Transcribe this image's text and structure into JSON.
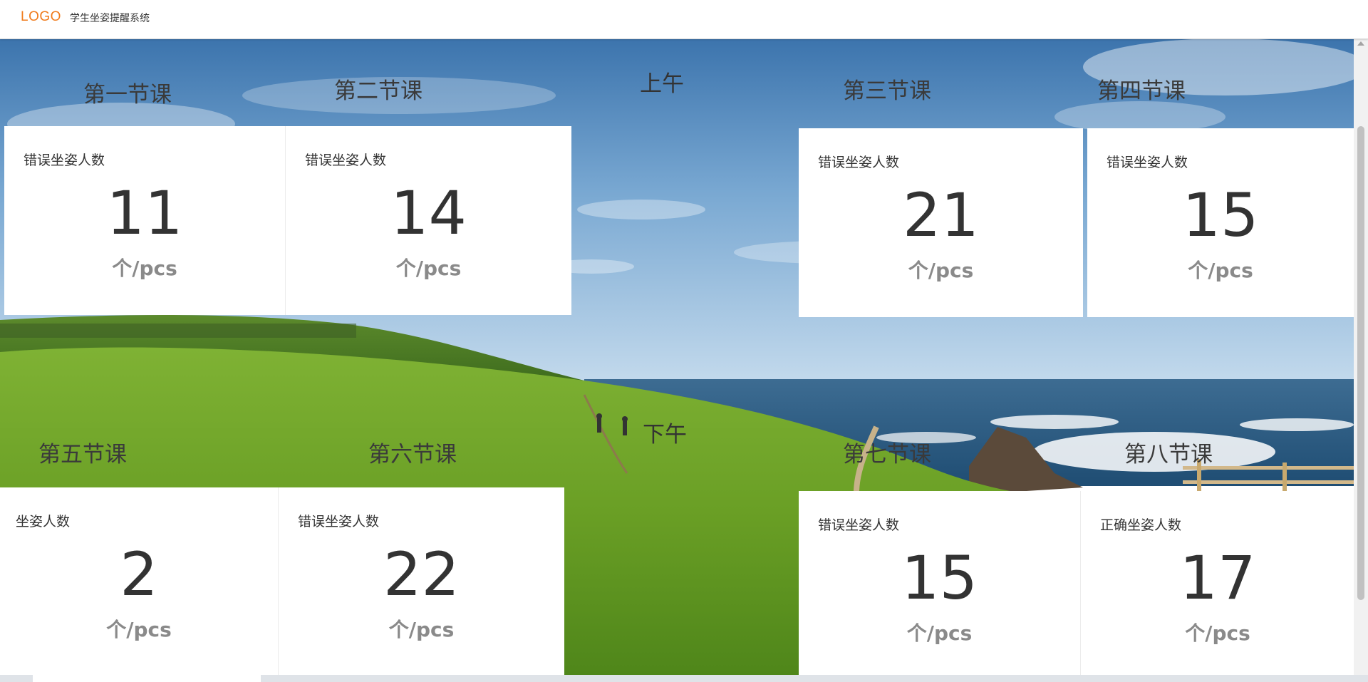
{
  "header": {
    "logo": "LOGO",
    "title": "学生坐姿提醒系统"
  },
  "periods": {
    "morning": "上午",
    "afternoon": "下午"
  },
  "sections": [
    {
      "heading": "第一节课",
      "label": "错误坐姿人数",
      "value": "11",
      "unit": "个/pcs"
    },
    {
      "heading": "第二节课",
      "label": "错误坐姿人数",
      "value": "14",
      "unit": "个/pcs"
    },
    {
      "heading": "第三节课",
      "label": "错误坐姿人数",
      "value": "21",
      "unit": "个/pcs"
    },
    {
      "heading": "第四节课",
      "label": "错误坐姿人数",
      "value": "15",
      "unit": "个/pcs"
    },
    {
      "heading": "第五节课",
      "label": "坐姿人数",
      "value": "2",
      "unit": "个/pcs"
    },
    {
      "heading": "第六节课",
      "label": "错误坐姿人数",
      "value": "22",
      "unit": "个/pcs"
    },
    {
      "heading": "第七节课",
      "label": "错误坐姿人数",
      "value": "15",
      "unit": "个/pcs"
    },
    {
      "heading": "第八节课",
      "label": "正确坐姿人数",
      "value": "17",
      "unit": "个/pcs"
    }
  ],
  "colors": {
    "logo": "#f07a1a",
    "sky_top": "#3f7bb5",
    "sky_bottom": "#a9c9e4",
    "grass": "#6fa62a",
    "sea": "#2f5f86"
  }
}
